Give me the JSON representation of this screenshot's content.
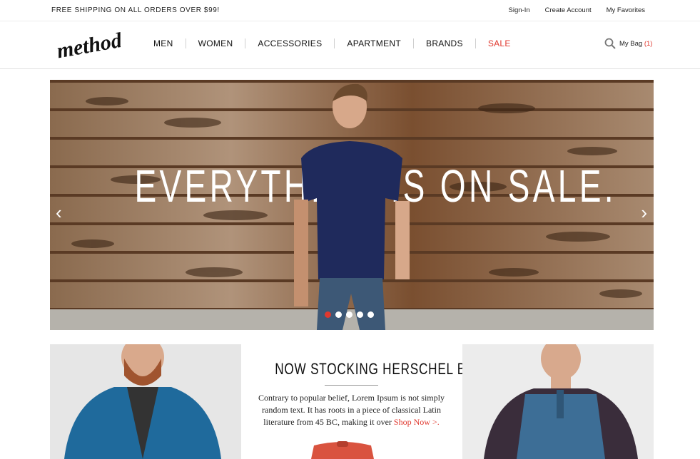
{
  "topbar": {
    "promo": "FREE SHIPPING ON ALL ORDERS OVER $99!",
    "links": [
      "Sign-In",
      "Create Account",
      "My Favorites"
    ]
  },
  "header": {
    "logo_text": "method",
    "nav": [
      "MEN",
      "WOMEN",
      "ACCESSORIES",
      "APARTMENT",
      "BRANDS",
      "SALE"
    ],
    "bag_label": "My Bag",
    "bag_count": "(1)"
  },
  "hero": {
    "headline": "EVERYTHING IS ON SALE.",
    "dots_total": 5,
    "dots_active": 1
  },
  "promo": {
    "title": "NOW STOCKING HERSCHEL BAGS.",
    "body": "Contrary to popular belief, Lorem Ipsum is not simply random text. It has roots in a piece of classical Latin literature from 45 BC, making it over ",
    "link": "Shop Now >."
  },
  "colors": {
    "accent": "#e0382e",
    "text": "#222222"
  }
}
